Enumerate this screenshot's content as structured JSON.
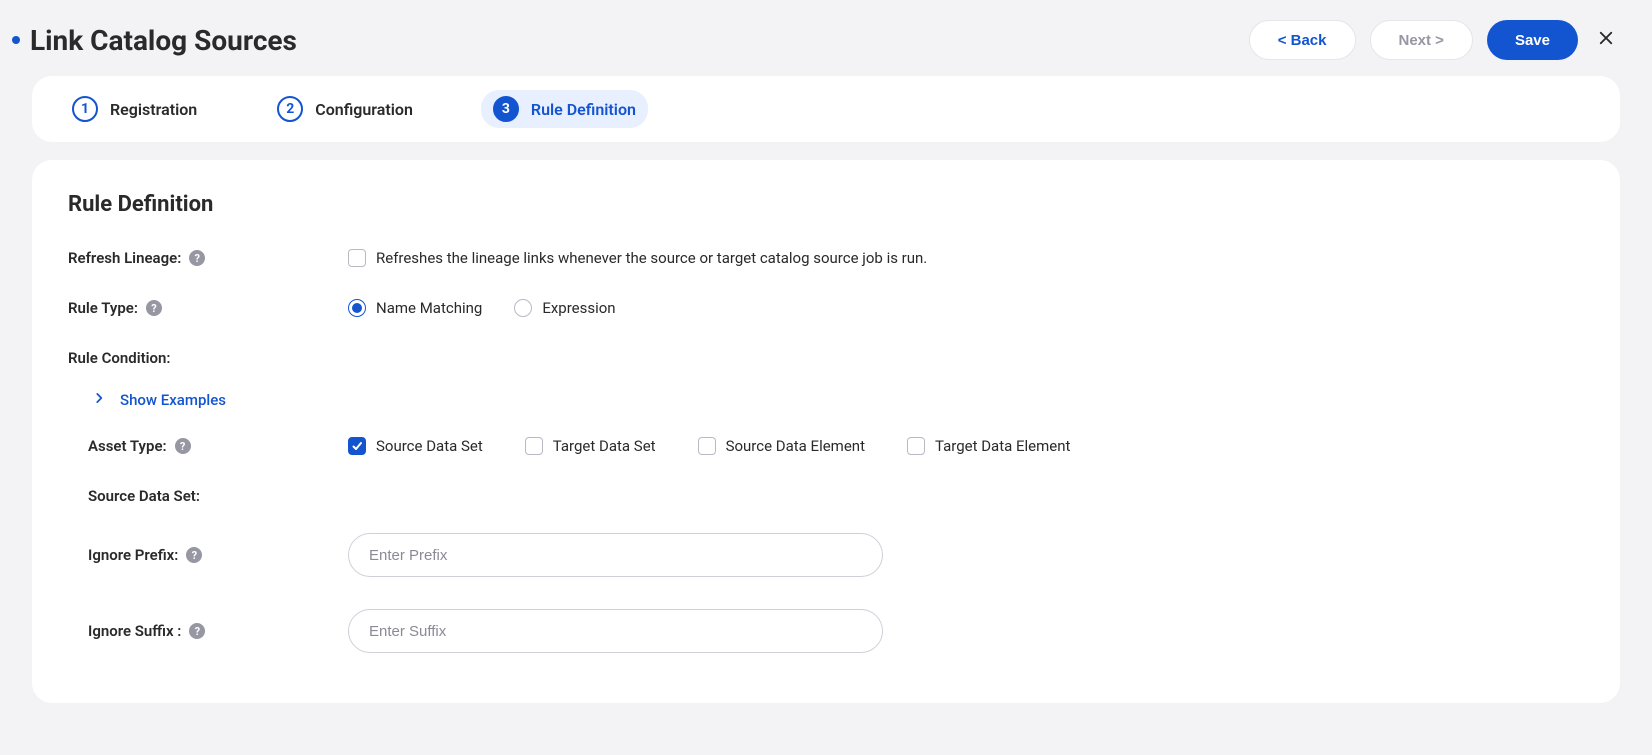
{
  "header": {
    "title": "Link Catalog Sources",
    "back": "< Back",
    "next": "Next >",
    "save": "Save"
  },
  "steps": [
    {
      "num": "1",
      "label": "Registration"
    },
    {
      "num": "2",
      "label": "Configuration"
    },
    {
      "num": "3",
      "label": "Rule Definition"
    }
  ],
  "section": {
    "title": "Rule Definition",
    "refresh_lineage_label": "Refresh Lineage:",
    "refresh_lineage_desc": "Refreshes the lineage links whenever the source or target catalog source job is run.",
    "rule_type_label": "Rule Type:",
    "rule_type_options": {
      "name_matching": "Name Matching",
      "expression": "Expression"
    },
    "rule_condition_label": "Rule Condition:",
    "show_examples": "Show Examples",
    "asset_type_label": "Asset Type:",
    "asset_type_options": {
      "source_data_set": "Source Data Set",
      "target_data_set": "Target Data Set",
      "source_data_element": "Source Data Element",
      "target_data_element": "Target Data Element"
    },
    "source_data_set_label": "Source Data Set:",
    "ignore_prefix_label": "Ignore Prefix:",
    "ignore_prefix_placeholder": "Enter Prefix",
    "ignore_suffix_label": "Ignore Suffix :",
    "ignore_suffix_placeholder": "Enter Suffix"
  }
}
